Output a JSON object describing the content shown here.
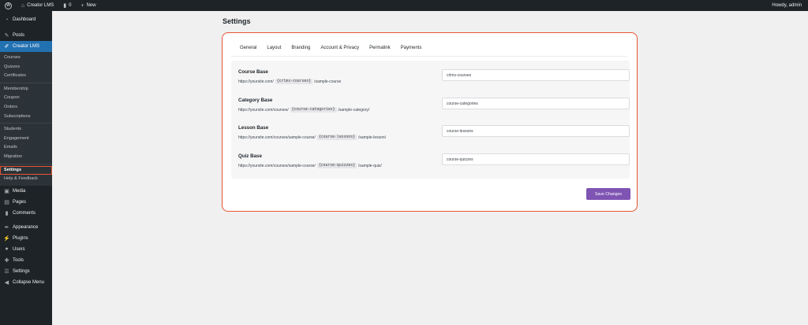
{
  "adminbar": {
    "site_name": "Creator LMS",
    "comments_count": "0",
    "new_label": "New",
    "howdy": "Howdy, admin"
  },
  "sidebar": {
    "dashboard": "Dashboard",
    "posts": "Posts",
    "creator_lms": "Creator LMS",
    "submenu": [
      "Courses",
      "Quizzes",
      "Certificates",
      "Membership",
      "Coupon",
      "Orders",
      "Subscriptions",
      "Students",
      "Engagement",
      "Emails",
      "Migration",
      "Settings",
      "Help & Feedback"
    ],
    "media": "Media",
    "pages": "Pages",
    "comments": "Comments",
    "appearance": "Appearance",
    "plugins": "Plugins",
    "users": "Users",
    "tools": "Tools",
    "settings": "Settings",
    "collapse": "Collapse Menu"
  },
  "page": {
    "title": "Settings"
  },
  "tabs": [
    "General",
    "Layout",
    "Branding",
    "Account & Privacy",
    "Permalink",
    "Payments"
  ],
  "active_tab": "Permalink",
  "fields": [
    {
      "title": "Course Base",
      "prefix": "https://yoursite.com/",
      "code": "{crlms-courses}",
      "suffix": "/sample-course",
      "value": "crlms-courses"
    },
    {
      "title": "Category Base",
      "prefix": "https://yoursite.com/courses/",
      "code": "{course-categories}",
      "suffix": "/sample-category/",
      "value": "course-categories"
    },
    {
      "title": "Lesson Base",
      "prefix": "https://yoursite.com/courses/sample-course/",
      "code": "{course-lessons}",
      "suffix": "/sample-lesson/",
      "value": "course-lessons"
    },
    {
      "title": "Quiz Base",
      "prefix": "https://yoursite.com/courses/sample-course/",
      "code": "{course-quizzes}",
      "suffix": "/sample-quiz/",
      "value": "course-quizzes"
    }
  ],
  "save_label": "Save Changes",
  "colors": {
    "accent": "#7f54b3",
    "highlight": "#e55532",
    "admin_dark": "#1d2327",
    "active_menu": "#2271b1"
  },
  "icons": {
    "wp_logo": "wordpress-logo-icon",
    "home": "home-icon",
    "comment": "comment-bubble-icon",
    "plus": "plus-icon"
  }
}
